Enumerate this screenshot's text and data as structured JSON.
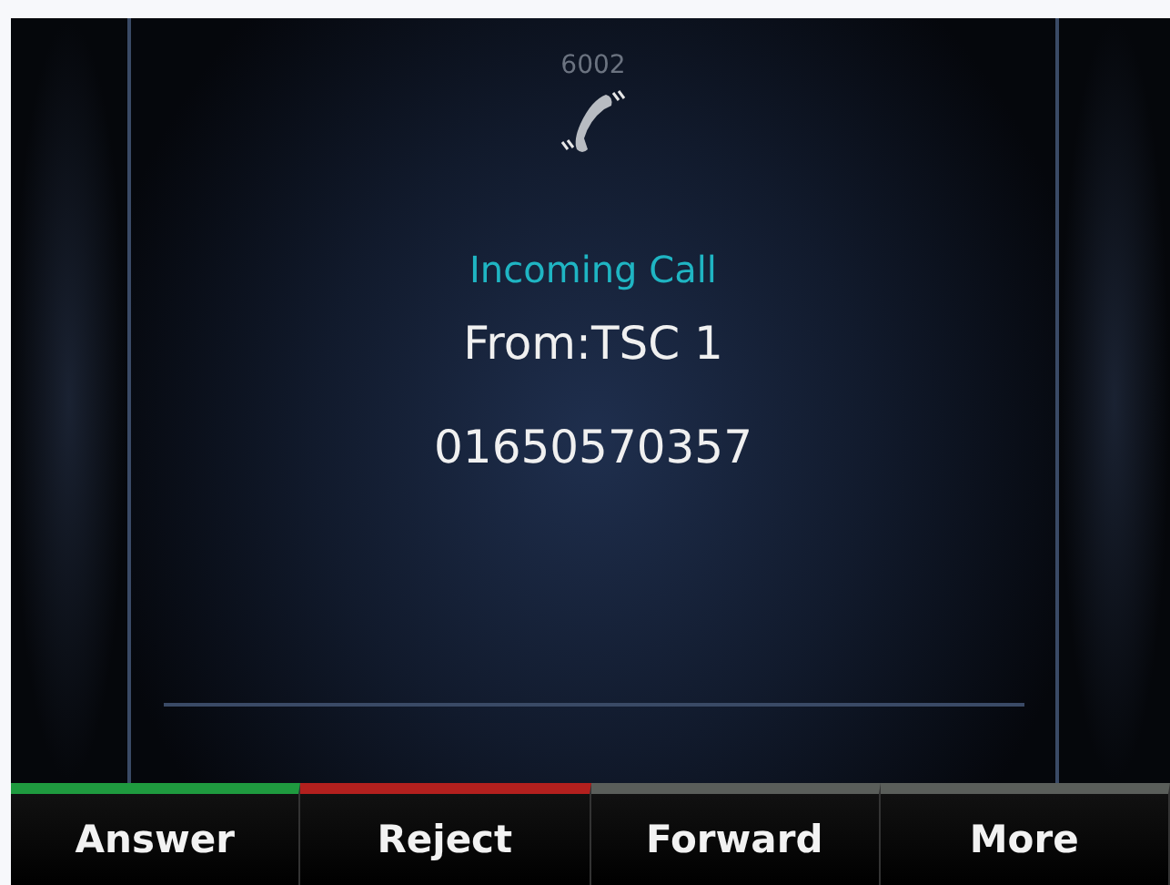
{
  "line": "6002",
  "call": {
    "status": "Incoming Call",
    "from": "From:TSC 1",
    "number": "01650570357"
  },
  "softkeys": [
    {
      "label": "Answer",
      "color": "#1f9a3f"
    },
    {
      "label": "Reject",
      "color": "#b3201e"
    },
    {
      "label": "Forward",
      "color": "#5a5e5a"
    },
    {
      "label": "More",
      "color": "#5a5e5a"
    }
  ]
}
